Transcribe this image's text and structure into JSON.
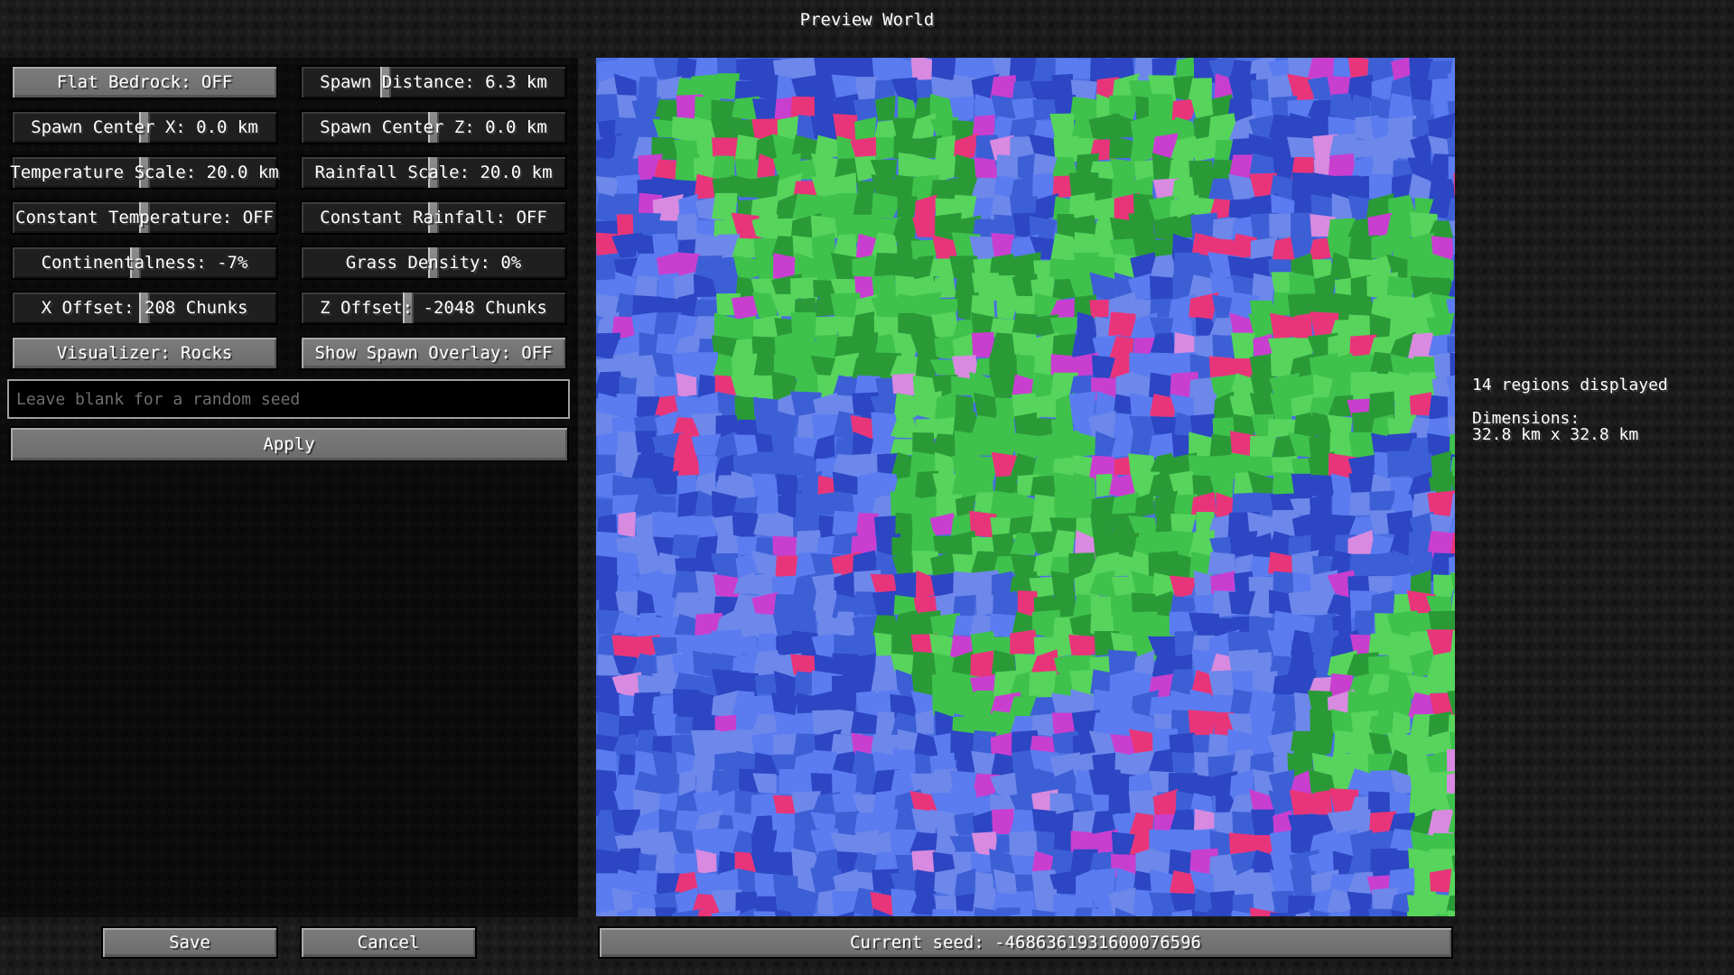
{
  "window": {
    "title": "Preview World"
  },
  "buttons": {
    "flat_bedrock": "Flat Bedrock: OFF",
    "spawn_distance": "Spawn Distance: 6.3 km",
    "spawn_center_x": "Spawn Center X: 0.0 km",
    "spawn_center_z": "Spawn Center Z: 0.0 km",
    "temperature_scale": "Temperature Scale: 20.0 km",
    "rainfall_scale": "Rainfall Scale: 20.0 km",
    "constant_temperature": "Constant Temperature: OFF",
    "constant_rainfall": "Constant Rainfall: OFF",
    "continentalness": "Continentalness: -7%",
    "grass_density": "Grass Density: 0%",
    "x_offset": "X Offset: 208 Chunks",
    "z_offset": "Z Offset: -2048 Chunks",
    "visualizer": "Visualizer: Rocks",
    "show_spawn_overlay": "Show Spawn Overlay: OFF",
    "apply": "Apply",
    "save": "Save",
    "cancel": "Cancel"
  },
  "seed_input": {
    "placeholder": "Leave blank for a random seed",
    "value": ""
  },
  "sliders": {
    "spawn_distance": 0.31,
    "spawn_center_x": 0.5,
    "spawn_center_z": 0.5,
    "temperature_scale": 0.5,
    "rainfall_scale": 0.5,
    "constant_temperature": 0.5,
    "constant_rainfall": 0.5,
    "continentalness": 0.465,
    "grass_density": 0.5,
    "x_offset": 0.5,
    "z_offset": 0.4
  },
  "info": {
    "regions": "14 regions displayed",
    "dimensions_label": "Dimensions:",
    "dimensions_value": "32.8 km x 32.8 km"
  },
  "seed_bar": "Current seed: -4686361931600076596",
  "map_colors": [
    "#3d5fd6",
    "#5a7cf0",
    "#6d88ea",
    "#2c46c4",
    "#3fc24c",
    "#2a9a37",
    "#56d45c",
    "#c83fd0",
    "#e8357a",
    "#d78ae0"
  ]
}
